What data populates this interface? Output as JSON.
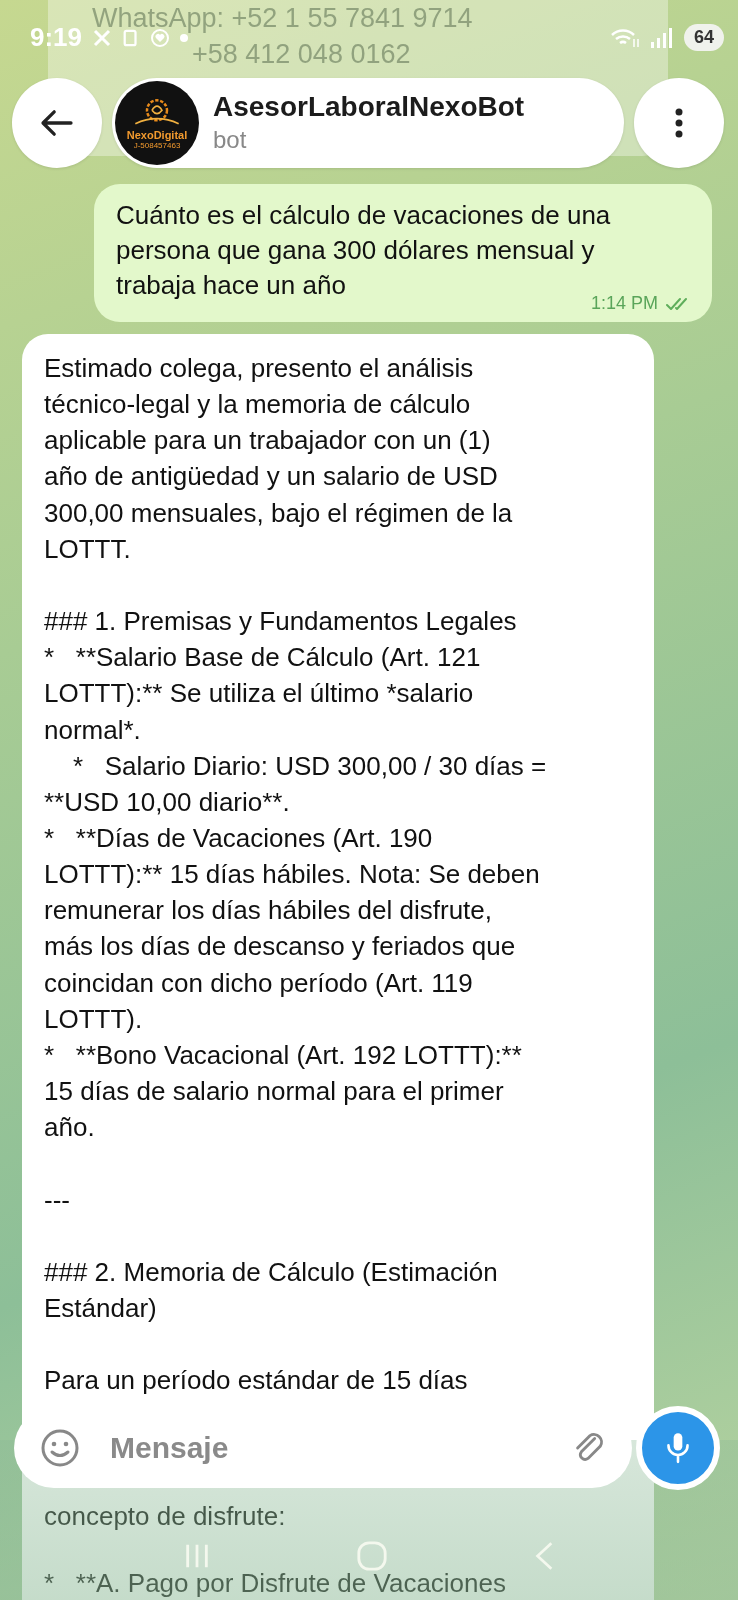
{
  "status_bar": {
    "time": "9:19",
    "battery": "64"
  },
  "previous_message": {
    "lines": [
      "WhatsApp: +52 1 55 7841 9714",
      "+58 412 048 0162"
    ]
  },
  "header": {
    "name": "AsesorLaboralNexoBot",
    "subtitle": "bot",
    "avatar": {
      "brand": "NexoDigital",
      "code": "J-508457463"
    }
  },
  "messages": [
    {
      "kind": "outgoing",
      "lines": [
        "Cuánto es el cálculo de vacaciones de una",
        "persona que gana 300 dólares mensual y",
        "trabaja hace un año"
      ],
      "time": "1:14 PM",
      "read": true
    },
    {
      "kind": "incoming",
      "paragraphs": [
        {
          "lines": [
            "Estimado colega, presento el análisis",
            "técnico-legal y la memoria de cálculo",
            "aplicable para un trabajador con un (1)",
            "año de antigüedad y un salario de USD",
            "300,00 mensuales, bajo el régimen de la",
            "LOTTT."
          ]
        },
        {
          "lines": [
            "### 1. Premisas y Fundamentos Legales",
            "*   **Salario Base de Cálculo (Art. 121",
            "LOTTT):** Se utiliza el último *salario",
            "normal*.",
            "    *   Salario Diario: USD 300,00 / 30 días =",
            "**USD 10,00 diario**.",
            "*   **Días de Vacaciones (Art. 190",
            "LOTTT):** 15 días hábiles. Nota: Se deben",
            "remunerar los días hábiles del disfrute,",
            "más los días de descanso y feriados que",
            "coincidan con dicho período (Art. 119",
            "LOTTT).",
            "*   **Bono Vacacional (Art. 192 LOTTT):**",
            "15 días de salario normal para el primer",
            "año."
          ]
        },
        {
          "lines": [
            "---"
          ]
        },
        {
          "lines": [
            "### 2. Memoria de Cálculo (Estimación",
            "Estándar)"
          ]
        },
        {
          "lines": [
            "Para un período estándar de 15 días"
          ]
        },
        {
          "lines": [
            "concepto de disfrute:"
          ]
        },
        {
          "lines": [
            "*   **A. Pago por Disfrute de Vacaciones"
          ]
        }
      ]
    }
  ],
  "composer": {
    "placeholder": "Mensaje"
  }
}
